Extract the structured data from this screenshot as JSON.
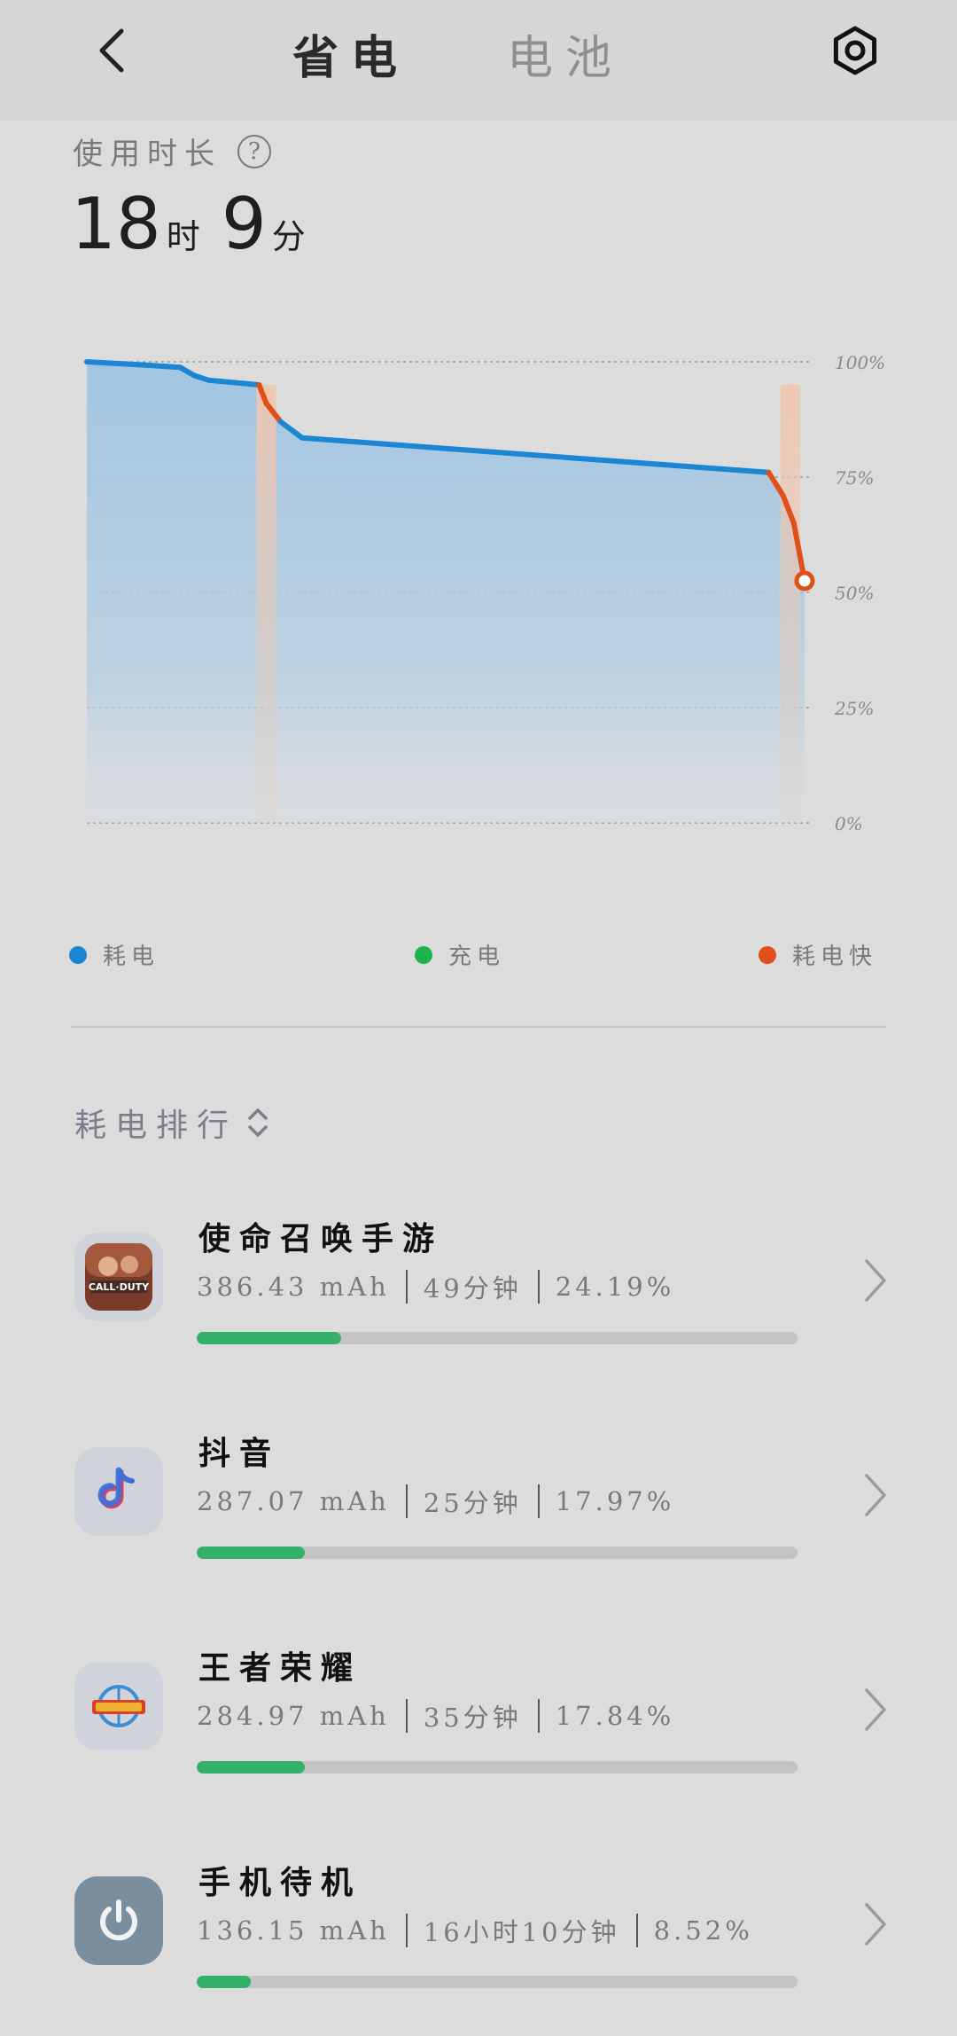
{
  "header": {
    "tabs": [
      {
        "label": "省电",
        "active": true
      },
      {
        "label": "电池",
        "active": false
      }
    ]
  },
  "usage": {
    "label": "使用时长",
    "hours": "18",
    "hours_unit": "时",
    "minutes": "9",
    "minutes_unit": "分"
  },
  "chart_data": {
    "type": "area",
    "x": [
      0,
      8,
      13,
      15,
      17,
      24,
      25,
      27,
      30,
      95,
      97,
      98.5,
      100
    ],
    "y": [
      100,
      99.3,
      98.8,
      97,
      96,
      95,
      91,
      87,
      83.5,
      76,
      71,
      65,
      52.5
    ],
    "fast_drain_segments": [
      [
        24,
        27
      ],
      [
        95,
        100
      ]
    ],
    "fast_drain_bands": [
      25,
      98
    ],
    "ylim": [
      0,
      100
    ],
    "y_tick_labels": [
      "100%",
      "75%",
      "50%",
      "25%",
      "0%"
    ],
    "y_ticks": [
      100,
      75,
      50,
      25,
      0
    ],
    "colors": {
      "drain": "#1a86d4",
      "fast": "#e0501a",
      "area": "#a9c8e0",
      "band": "#ecc7b3"
    }
  },
  "legend": [
    {
      "label": "耗电",
      "color": "#1a86d4"
    },
    {
      "label": "充电",
      "color": "#1db34d"
    },
    {
      "label": "耗电快",
      "color": "#e0501a"
    }
  ],
  "ranking": {
    "title": "耗电排行"
  },
  "apps": [
    {
      "name": "使命召唤手游",
      "mah": "386.43 mAh",
      "duration": "49分钟",
      "percent": "24.19%",
      "share": 0.24,
      "icon": "call-of-duty-icon"
    },
    {
      "name": "抖音",
      "mah": "287.07 mAh",
      "duration": "25分钟",
      "percent": "17.97%",
      "share": 0.18,
      "icon": "douyin-icon"
    },
    {
      "name": "王者荣耀",
      "mah": "284.97 mAh",
      "duration": "35分钟",
      "percent": "17.84%",
      "share": 0.18,
      "icon": "honor-of-kings-icon"
    },
    {
      "name": "手机待机",
      "mah": "136.15 mAh",
      "duration": "16小时10分钟",
      "percent": "8.52%",
      "share": 0.09,
      "icon": "power-icon"
    }
  ]
}
